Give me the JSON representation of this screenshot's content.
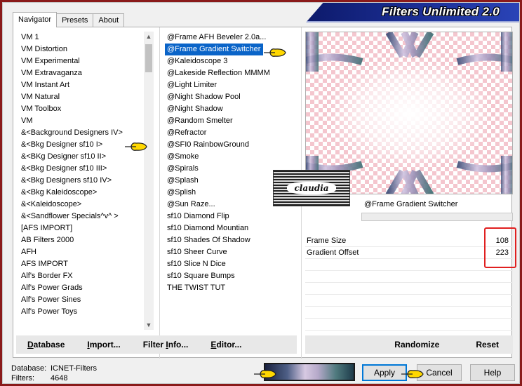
{
  "window": {
    "title": "Filters Unlimited 2.0"
  },
  "tabs": [
    {
      "label": "Navigator",
      "active": true
    },
    {
      "label": "Presets",
      "active": false
    },
    {
      "label": "About",
      "active": false
    }
  ],
  "categories": [
    "VM 1",
    "VM Distortion",
    "VM Experimental",
    "VM Extravaganza",
    "VM Instant Art",
    "VM Natural",
    "VM Toolbox",
    "VM",
    "&<Background Designers IV>",
    "&<Bkg Designer sf10 I>",
    "&<BKg Designer sf10 II>",
    "&<Bkg Designer sf10 III>",
    "&<Bkg Designers sf10 IV>",
    "&<Bkg Kaleidoscope>",
    "&<Kaleidoscope>",
    "&<Sandflower Specials^v^ >",
    "[AFS IMPORT]",
    "AB Filters 2000",
    "AFH",
    "AFS IMPORT",
    "Alf's Border FX",
    "Alf's Power Grads",
    "Alf's Power Sines",
    "Alf's Power Toys"
  ],
  "filters": [
    "@Frame AFH Beveler 2.0a...",
    "@Frame Gradient Switcher",
    "@Kaleidoscope 3",
    "@Lakeside Reflection MMMM",
    "@Light Limiter",
    "@Night Shadow Pool",
    "@Night Shadow",
    "@Random Smelter",
    "@Refractor",
    "@SFI0 RainbowGround",
    "@Smoke",
    "@Spirals",
    "@Splash",
    "@Splish",
    "@Sun Raze...",
    "sf10 Diamond Flip",
    "sf10 Diamond Mountian",
    "sf10 Shades Of Shadow",
    "sf10 Sheer Curve",
    "sf10 Slice N Dice",
    "sf10 Square Bumps",
    "THE TWIST TUT"
  ],
  "selected_filter_index": 1,
  "selected_filter_name": "@Frame Gradient Switcher",
  "logo_text": "claudia",
  "params": [
    {
      "label": "Frame Size",
      "value": "108"
    },
    {
      "label": "Gradient Offset",
      "value": "223"
    }
  ],
  "left_buttons": [
    {
      "name": "database",
      "u": "D",
      "rest": "atabase"
    },
    {
      "name": "import",
      "u": "I",
      "rest": "mport..."
    },
    {
      "name": "filter-info",
      "pre": "Filter ",
      "u": "I",
      "rest": "nfo..."
    },
    {
      "name": "editor",
      "u": "E",
      "rest": "ditor..."
    }
  ],
  "right_buttons": {
    "randomize": "Randomize",
    "reset": "Reset"
  },
  "status": {
    "database_label": "Database:",
    "database_value": "ICNET-Filters",
    "filters_label": "Filters:",
    "filters_value": "4648"
  },
  "dialog_buttons": {
    "apply": "Apply",
    "cancel": "Cancel",
    "help": "Help"
  },
  "colors": {
    "selection": "#0a64c8",
    "highlight_box": "#e02020",
    "title_banner": "#1c2f96"
  }
}
